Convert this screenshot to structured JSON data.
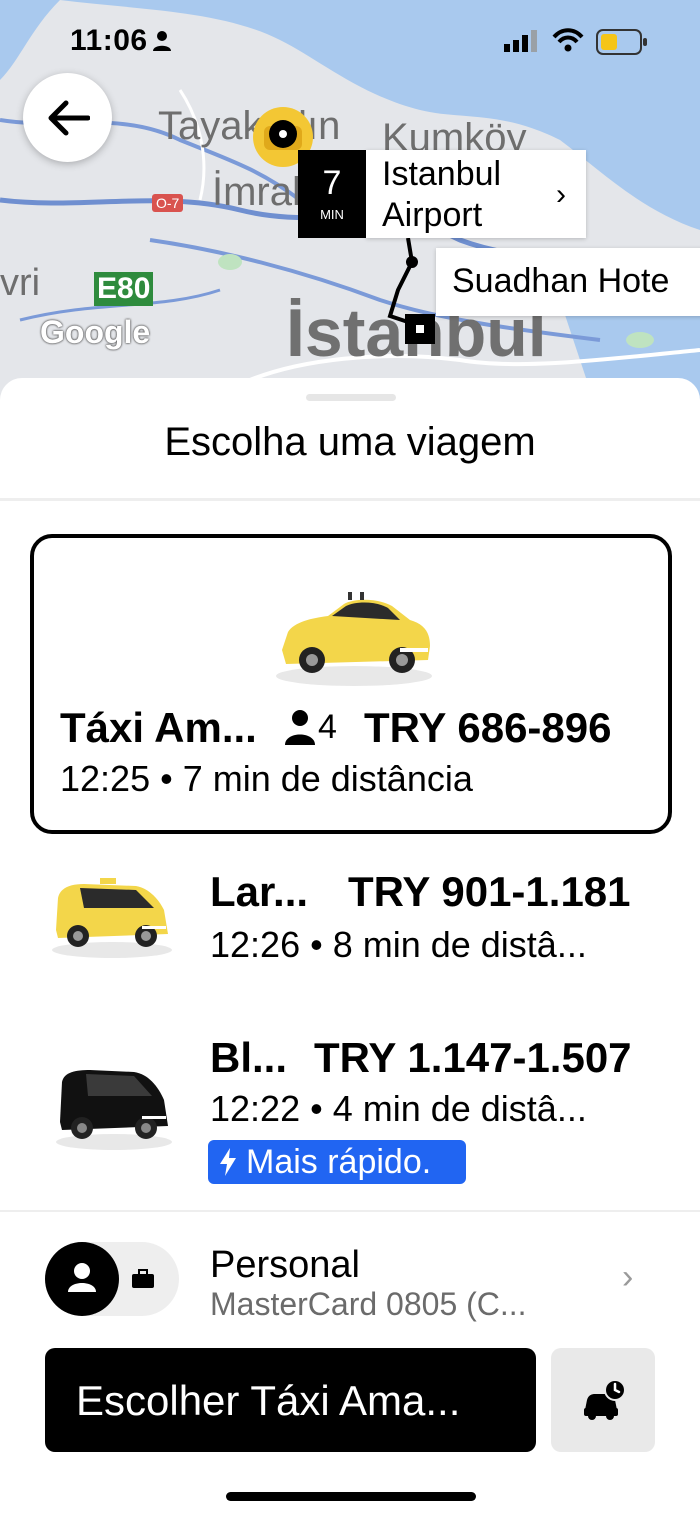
{
  "status_bar": {
    "time": "11:06"
  },
  "map": {
    "labels": {
      "tayakadin": "Tayakadın",
      "kumkoy": "Kumköy",
      "imrahor": "İmrah",
      "o7": "O-7",
      "e80": "E80",
      "vri": "vri",
      "istanbul": "İstanbul",
      "google": "Google"
    },
    "destination": {
      "eta_value": "7",
      "eta_unit": "MIN",
      "name": "Istanbul Airport"
    },
    "origin": {
      "name": "Suadhan Hote"
    }
  },
  "sheet": {
    "title": "Escolha uma viagem"
  },
  "rides": [
    {
      "name": "Táxi Am...",
      "seats": "4",
      "price": "TRY 686-896",
      "subtitle": "12:25 • 7 min de distância",
      "color": "#f3d64a"
    },
    {
      "name": "Lar...",
      "price": "TRY 901-1.181",
      "subtitle": "12:26 • 8 min de distâ...",
      "color": "#f3d64a"
    },
    {
      "name": "Bl...",
      "price": "TRY 1.147-1.507",
      "subtitle": "12:22 • 4 min de distâ...",
      "badge": "Mais rápido.",
      "color": "#111111"
    }
  ],
  "payment": {
    "title": "Personal",
    "subtitle": "MasterCard 0805 (C..."
  },
  "actions": {
    "choose_label": "Escolher Táxi Ama..."
  },
  "colors": {
    "accent_blue": "#2165f2",
    "map_water": "#a9c9ee",
    "route": "#000000"
  }
}
